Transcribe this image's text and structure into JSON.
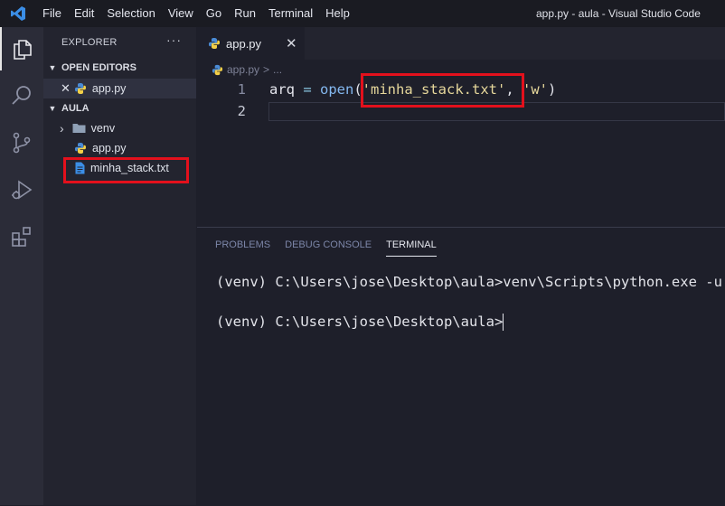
{
  "titlebar": {
    "menu": [
      "File",
      "Edit",
      "Selection",
      "View",
      "Go",
      "Run",
      "Terminal",
      "Help"
    ],
    "window_title": "app.py - aula - Visual Studio Code"
  },
  "activity_bar": {
    "items": [
      "explorer-icon",
      "search-icon",
      "source-control-icon",
      "run-debug-icon",
      "extensions-icon"
    ]
  },
  "sidebar": {
    "header": "EXPLORER",
    "more": "···",
    "open_editors": {
      "title": "OPEN EDITORS",
      "close_glyph": "✕",
      "files": [
        {
          "name": "app.py",
          "icon": "python-icon"
        }
      ]
    },
    "workspace": {
      "title": "AULA",
      "items": [
        {
          "name": "venv",
          "type": "folder"
        },
        {
          "name": "app.py",
          "type": "python"
        },
        {
          "name": "minha_stack.txt",
          "type": "text"
        }
      ]
    }
  },
  "editor": {
    "tab": {
      "label": "app.py",
      "close": "✕"
    },
    "breadcrumb": {
      "file": "app.py",
      "sep": ">",
      "rest": "..."
    },
    "lines": [
      {
        "number": "1",
        "tokens": [
          "arq",
          " = ",
          "open",
          "(",
          "'minha_stack.txt'",
          ", ",
          "'w'",
          ")"
        ]
      },
      {
        "number": "2"
      }
    ]
  },
  "panel": {
    "tabs": [
      "PROBLEMS",
      "DEBUG CONSOLE",
      "TERMINAL"
    ],
    "active_tab": "TERMINAL",
    "terminal_lines": [
      "(venv) C:\\Users\\jose\\Desktop\\aula>venv\\Scripts\\python.exe -u \"c",
      "(venv) C:\\Users\\jose\\Desktop\\aula>"
    ]
  },
  "colors": {
    "highlight_box": "#e3101c",
    "accent_blue": "#3b8ee6",
    "python_blue": "#4a8bd6",
    "python_yellow": "#f3cf47"
  }
}
